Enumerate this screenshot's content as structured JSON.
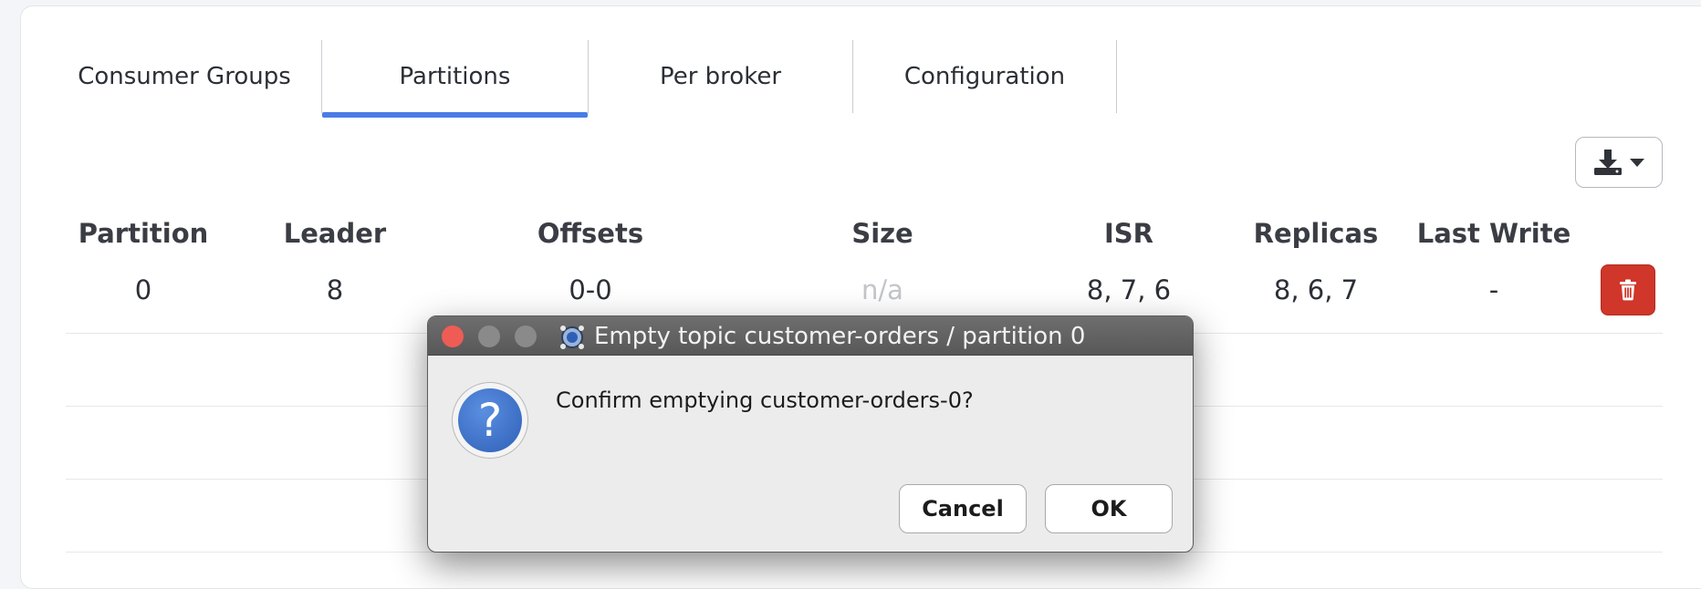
{
  "tabs": [
    {
      "label": "Consumer Groups",
      "active": false
    },
    {
      "label": "Partitions",
      "active": true
    },
    {
      "label": "Per broker",
      "active": false
    },
    {
      "label": "Configuration",
      "active": false
    }
  ],
  "export": {
    "icon": "download-icon",
    "caret": "chevron-down-icon"
  },
  "table": {
    "columns": [
      "Partition",
      "Leader",
      "Offsets",
      "Size",
      "ISR",
      "Replicas",
      "Last Write"
    ],
    "rows": [
      {
        "partition": "0",
        "leader": "8",
        "offsets": "0-0",
        "size": "n/a",
        "isr": "8, 7, 6",
        "replicas": "8, 6, 7",
        "last_write": "-"
      }
    ],
    "delete_icon": "trash-icon"
  },
  "dialog": {
    "title": "Empty topic customer-orders / partition 0",
    "message": "Confirm emptying customer-orders-0?",
    "cancel_label": "Cancel",
    "ok_label": "OK",
    "icon": "question-icon"
  },
  "colors": {
    "accent": "#4a7ce6",
    "danger": "#d0362a",
    "close_light": "#ef5c55"
  }
}
